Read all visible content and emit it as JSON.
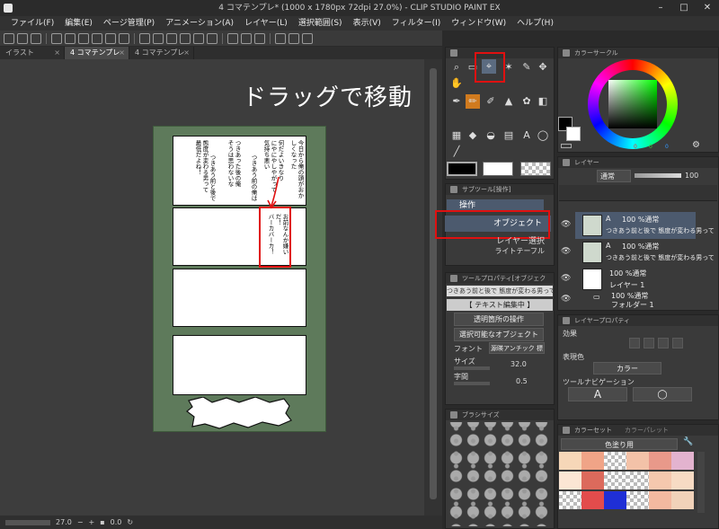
{
  "window": {
    "title": "4 コマテンプレ* (1000 x 1780px 72dpi 27.0%) - CLIP STUDIO PAINT EX",
    "minimize": "–",
    "maximize": "□",
    "close": "✕"
  },
  "menu": [
    "ファイル(F)",
    "編集(E)",
    "ページ管理(P)",
    "アニメーション(A)",
    "レイヤー(L)",
    "選択範囲(S)",
    "表示(V)",
    "フィルター(I)",
    "ウィンドウ(W)",
    "ヘルプ(H)"
  ],
  "tabs": [
    "イラスト",
    "4 コマテンプレ*",
    "4 コマテンプレ"
  ],
  "annotation": "ドラッグで移動",
  "manga": {
    "p1_col1": "今日から俺の頭がおかしくなった",
    "p1_col2": "何だよいきなり",
    "p1_col3": "にやにやしやがって",
    "p1_col4": "気持ち悪い",
    "p1_col5": "つきあう前の俺は",
    "p1_col6": "つきあった後の俺",
    "p1_col7": "そうは思わないな",
    "p1_col8": "つきあう前と後で",
    "p1_col9": "態度が変わる男って",
    "p1_col10": "最低だよね！",
    "p2_b1": "バーカバーカ！",
    "p2_b2": "お前なんか嫌いだ！"
  },
  "status": {
    "zoom": "27.0",
    "angle": "0.0"
  },
  "tool_panel": {
    "labels": [
      "A"
    ]
  },
  "subtool": {
    "header": "サブツール[操作]",
    "items": [
      "操作",
      "オブジェクト",
      "レイヤー選択",
      "ライトテーブル"
    ]
  },
  "tool_property": {
    "header": "ツールプロパティ[オブジェクト]",
    "preview": "つきあう前と後で 態度が変わる男って 最低だよね",
    "editing": "【 テキスト編集中 】",
    "transparent_op": "透明箇所の操作",
    "selectable_obj": "選択可能なオブジェクト",
    "font_label": "フォント",
    "font_value": "源暎アンチック 標準",
    "size_label": "サイズ",
    "size_value": "32.0",
    "spacing_label": "字間",
    "spacing_value": "0.5"
  },
  "brush_size": {
    "header": "ブラシサイズ"
  },
  "color_circle": {
    "header": "カラーサークル",
    "readout": [
      "0",
      "0",
      "0"
    ]
  },
  "layer_panel": {
    "header": "レイヤー",
    "blend": "通常",
    "opacity": "100",
    "layers": [
      {
        "title": "100 %通常",
        "name": "つきあう前と後で 態度が変わる男って"
      },
      {
        "title": "100 %通常",
        "name": "つきあう前と後で 態度が変わる男って"
      },
      {
        "title": "100 %通常",
        "name": "レイヤー 1"
      },
      {
        "title": "100 %通常",
        "name": "フォルダー 1"
      }
    ]
  },
  "layer_property": {
    "header": "レイヤープロパティ",
    "effect": "効果",
    "expression_color": "表現色",
    "color_value": "カラー",
    "tool_nav": "ツールナビゲーション",
    "nav_text": "A"
  },
  "color_set": {
    "header": "カラーセット",
    "header2": "カラーパレット",
    "set_name": "色塗り用"
  },
  "colors": {
    "accent_red": "#e01010",
    "page_green": "#5e7a5b",
    "selected_layer": "#4c5a6e"
  }
}
